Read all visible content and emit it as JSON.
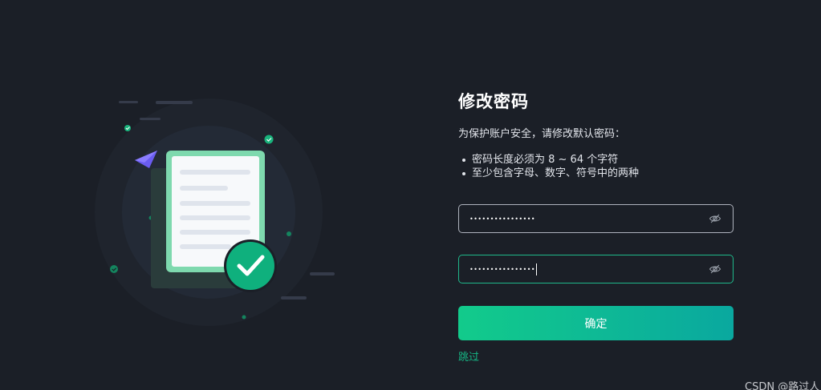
{
  "title": "修改密码",
  "subtitle": "为保护账户安全，请修改默认密码：",
  "rules": [
    "密码长度必须为 8 ~ 64 个字符",
    "至少包含字母、数字、符号中的两种"
  ],
  "new_password": {
    "masked_value": "••••••••••••••••",
    "visibility_icon": "eye-hidden-icon"
  },
  "confirm_password": {
    "masked_value": "••••••••••••••••",
    "visibility_icon": "eye-hidden-icon"
  },
  "confirm_button_label": "确定",
  "skip_link_label": "跳过",
  "watermark": "CSDN @路过人",
  "colors": {
    "background": "#1b1f27",
    "accent": "#12cb8b",
    "accent_end": "#0aa89f",
    "focus_border": "#1fb88a",
    "link": "#16b785"
  }
}
